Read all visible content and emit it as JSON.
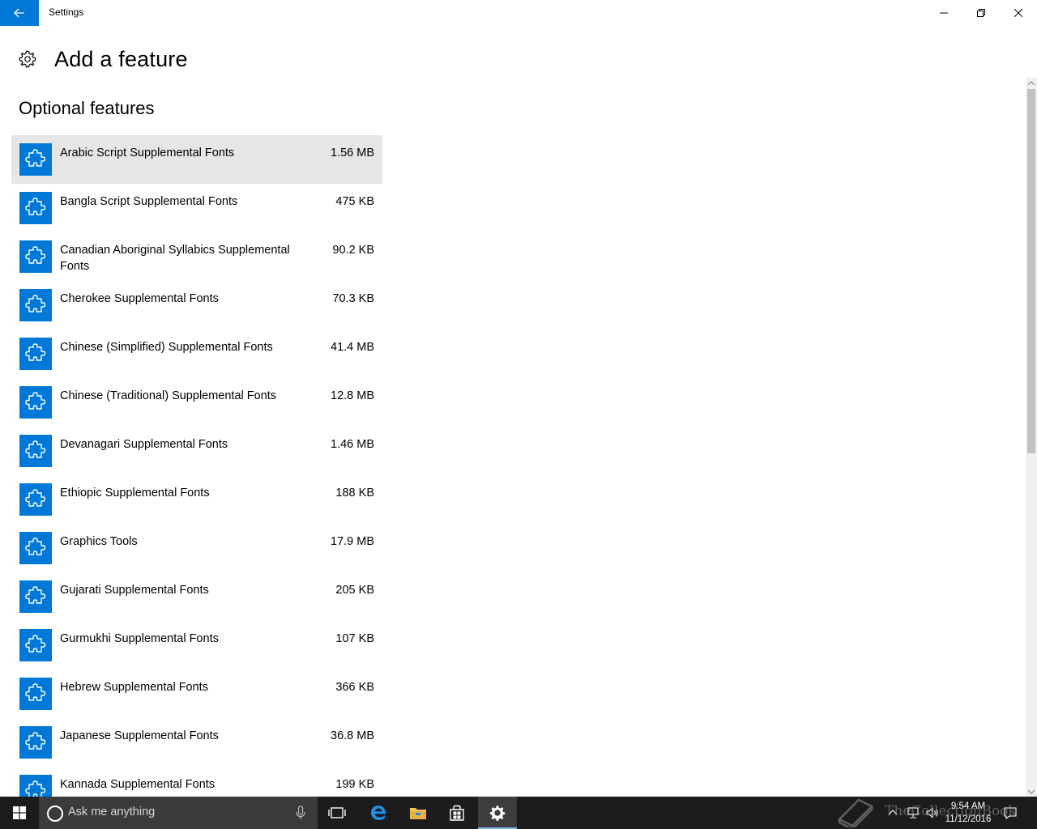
{
  "window": {
    "app_title": "Settings"
  },
  "header": {
    "title": "Add a feature"
  },
  "section": {
    "title": "Optional features"
  },
  "features": [
    {
      "name": "Arabic Script Supplemental Fonts",
      "size": "1.56 MB"
    },
    {
      "name": "Bangla Script Supplemental Fonts",
      "size": "475 KB"
    },
    {
      "name": "Canadian Aboriginal Syllabics Supplemental Fonts",
      "size": "90.2 KB"
    },
    {
      "name": "Cherokee Supplemental Fonts",
      "size": "70.3 KB"
    },
    {
      "name": "Chinese (Simplified) Supplemental Fonts",
      "size": "41.4 MB"
    },
    {
      "name": "Chinese (Traditional) Supplemental Fonts",
      "size": "12.8 MB"
    },
    {
      "name": "Devanagari Supplemental Fonts",
      "size": "1.46 MB"
    },
    {
      "name": "Ethiopic Supplemental Fonts",
      "size": "188 KB"
    },
    {
      "name": "Graphics Tools",
      "size": "17.9 MB"
    },
    {
      "name": "Gujarati Supplemental Fonts",
      "size": "205 KB"
    },
    {
      "name": "Gurmukhi Supplemental Fonts",
      "size": "107 KB"
    },
    {
      "name": "Hebrew Supplemental Fonts",
      "size": "366 KB"
    },
    {
      "name": "Japanese Supplemental Fonts",
      "size": "36.8 MB"
    },
    {
      "name": "Kannada Supplemental Fonts",
      "size": "199 KB"
    }
  ],
  "taskbar": {
    "search_placeholder": "Ask me anything",
    "time": "9:54 AM",
    "date": "11/12/2016"
  },
  "watermark": {
    "text": "TheCollectionBook"
  },
  "colors": {
    "accent": "#0078d7",
    "selected_row": "#e6e6e6",
    "taskbar": "#1c1c1c"
  }
}
